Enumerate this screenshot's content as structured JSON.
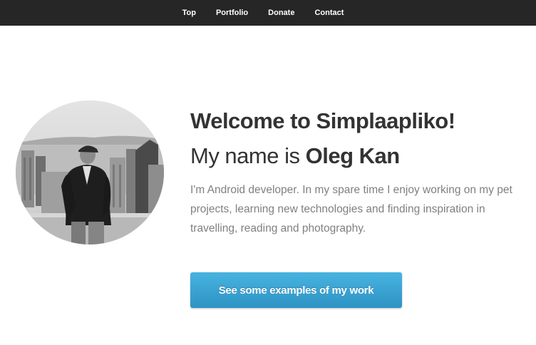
{
  "nav": {
    "items": [
      {
        "label": "Top"
      },
      {
        "label": "Portfolio"
      },
      {
        "label": "Donate"
      },
      {
        "label": "Contact"
      }
    ]
  },
  "hero": {
    "welcome": "Welcome to Simplaapliko!",
    "name_prefix": "My name is ",
    "name": "Oleg Kan",
    "bio": "I'm Android developer. In my spare time I enjoy working on my pet projects, learning new technologies and finding inspiration in travelling, reading and photography.",
    "cta_label": "See some examples of my work"
  },
  "colors": {
    "navbar": "#262626",
    "heading": "#333333",
    "body_text": "#808080",
    "button": "#3aa3d4"
  }
}
